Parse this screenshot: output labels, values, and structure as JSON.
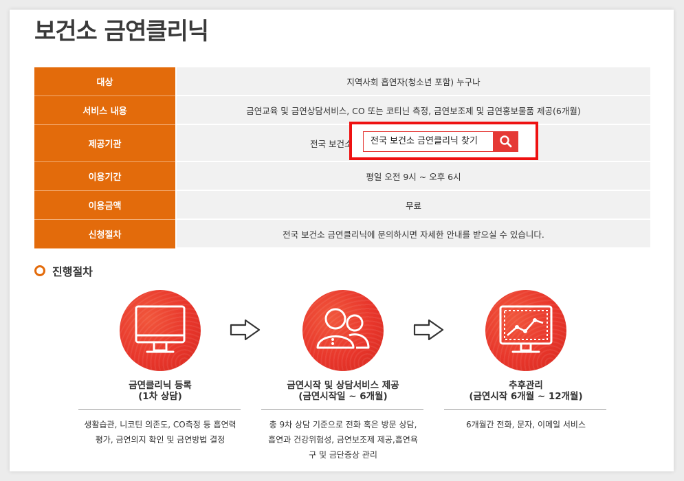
{
  "page": {
    "title": "보건소 금연클리닉"
  },
  "table": {
    "rows": [
      {
        "label": "대상",
        "value": "지역사회 흡연자(청소년 포함) 누구나"
      },
      {
        "label": "서비스 내용",
        "value": "금연교육 및 금연상담서비스, CO 또는 코티닌 측정, 금연보조제 및 금연홍보물품 제공(6개월)"
      },
      {
        "label": "제공기관",
        "value": "전국 보건소"
      },
      {
        "label": "이용기간",
        "value": "평일 오전 9시 ~ 오후 6시"
      },
      {
        "label": "이용금액",
        "value": "무료"
      },
      {
        "label": "신청절차",
        "value": "전국 보건소 금연클리닉에 문의하시면 자세한 안내를 받으실 수 있습니다."
      }
    ],
    "search_label": "전국 보건소 금연클리닉 찾기"
  },
  "section": {
    "title": "진행절차"
  },
  "steps": [
    {
      "title1": "금연클리닉 등록",
      "title2": "(1차 상담)",
      "desc1": "생활습관, 니코틴 의존도, CO측정 등 흡연력",
      "desc2": "평가, 금연의지 확인 및 금연방법 결정",
      "desc3": ""
    },
    {
      "title1": "금연시작 및 상담서비스 제공",
      "title2": "(금연시작일 ~ 6개월)",
      "desc1": "총 9차 상담 기준으로 전화 혹은 방문 상담,",
      "desc2": "흡연과 건강위험성, 금연보조제 제공,흡연욕",
      "desc3": "구 및 금단증상 관리"
    },
    {
      "title1": "추후관리",
      "title2": "(금연시작 6개월 ~ 12개월)",
      "desc1": "6개월간 전화, 문자, 이메일 서비스",
      "desc2": "",
      "desc3": ""
    }
  ],
  "icons": {
    "step1": "monitor-icon",
    "step2": "people-icon",
    "step3": "chart-monitor-icon",
    "search": "search-icon",
    "arrow": "arrow-right-icon"
  },
  "colors": {
    "label_bg": "#e36b0b",
    "accent_red": "#e53935",
    "highlight": "#ee1111"
  }
}
